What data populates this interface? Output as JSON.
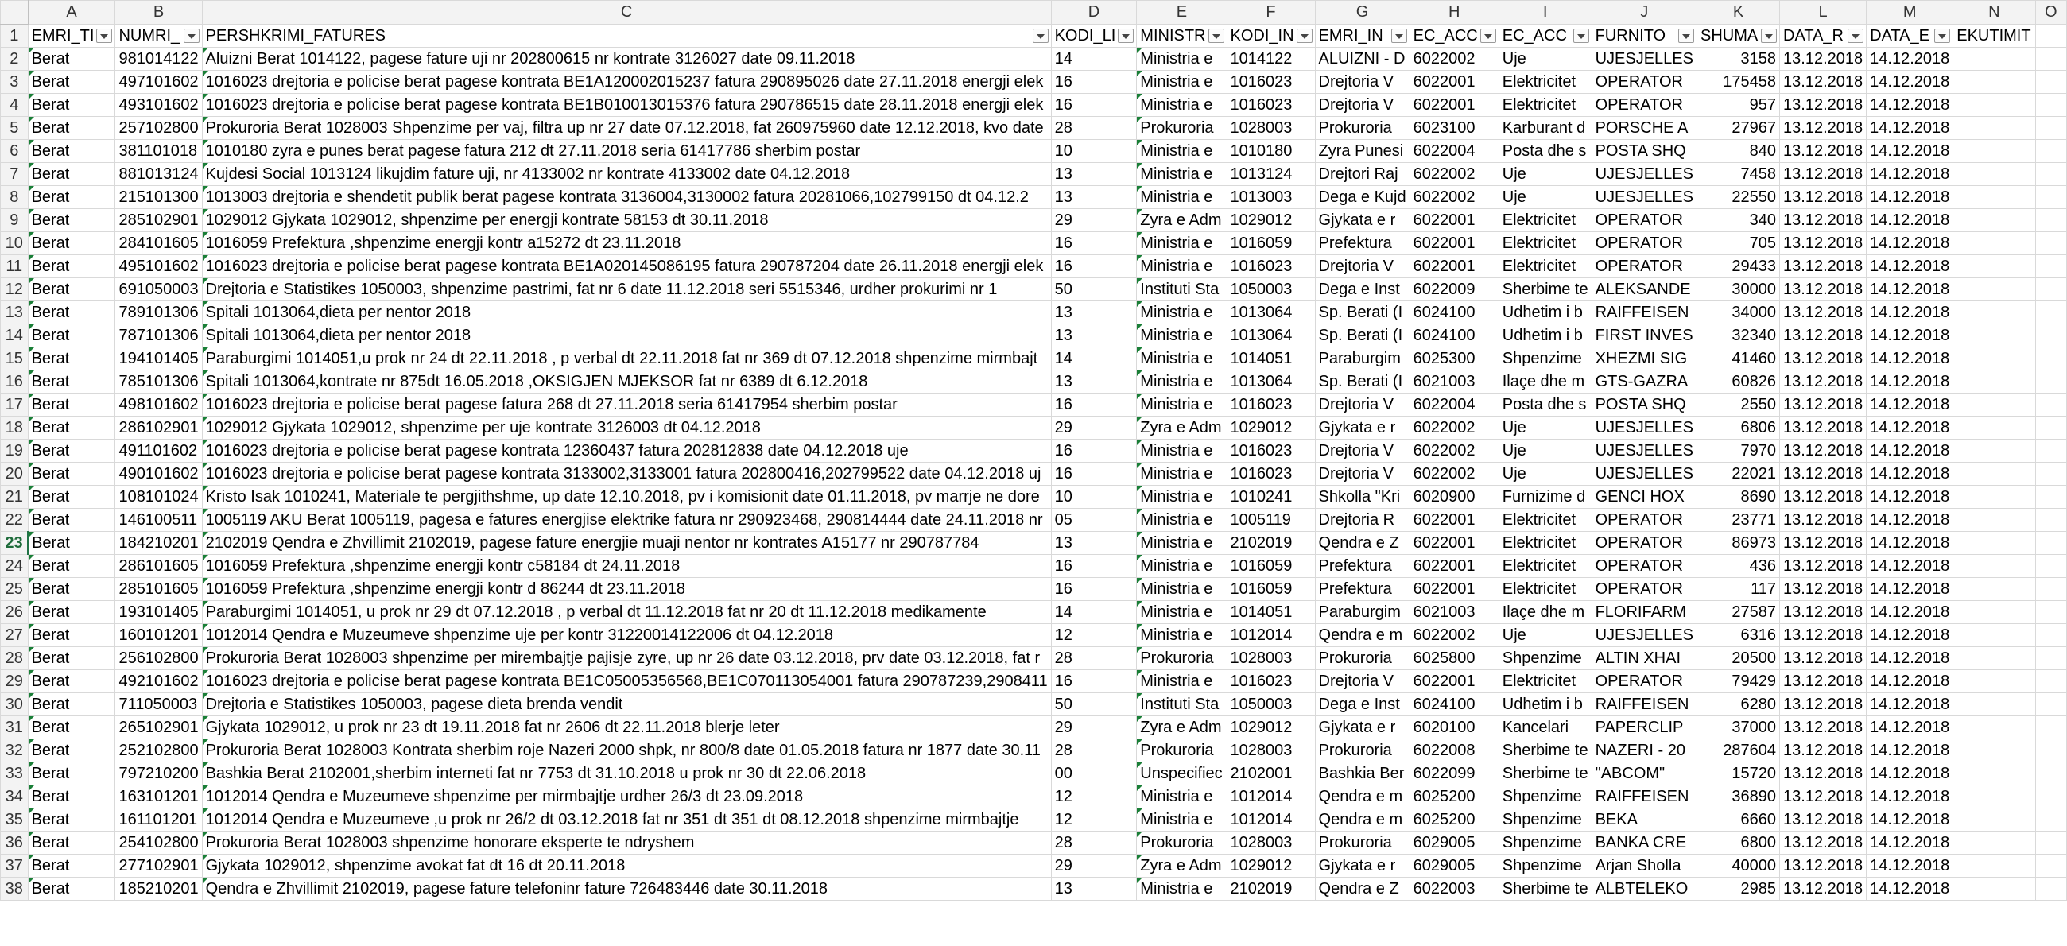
{
  "columns": [
    "A",
    "B",
    "C",
    "D",
    "E",
    "F",
    "G",
    "H",
    "I",
    "J",
    "K",
    "L",
    "M",
    "N",
    "O"
  ],
  "headers": [
    "EMRI_TI",
    "NUMRI_",
    "PERSHKRIMI_FATURES",
    "KODI_LI",
    "MINISTR",
    "KODI_IN",
    "EMRI_IN",
    "EC_ACC",
    "EC_ACC",
    "FURNITO",
    "SHUMA",
    "DATA_R",
    "DATA_E",
    "EKUTIMIT",
    ""
  ],
  "active_row": "23",
  "rows": [
    [
      "2",
      "Berat",
      "981014122",
      "Aluizni Berat 1014122, pagese fature uji nr 202800615 nr kontrate 3126027 date 09.11.2018",
      "14",
      "Ministria e",
      "1014122",
      "ALUIZNI - D",
      "6022002",
      "Uje",
      "UJESJELLES",
      "3158",
      "13.12.2018",
      "14.12.2018"
    ],
    [
      "3",
      "Berat",
      "497101602",
      "1016023 drejtoria e policise berat pagese kontrata BE1A120002015237 fatura 290895026 date 27.11.2018 energji elek",
      "16",
      "Ministria e",
      "1016023",
      "Drejtoria V",
      "6022001",
      "Elektricitet",
      "OPERATOR",
      "175458",
      "13.12.2018",
      "14.12.2018"
    ],
    [
      "4",
      "Berat",
      "493101602",
      "1016023 drejtoria e policise berat pagese kontrata BE1B010013015376 fatura 290786515 date 28.11.2018 energji elek",
      "16",
      "Ministria e",
      "1016023",
      "Drejtoria V",
      "6022001",
      "Elektricitet",
      "OPERATOR",
      "957",
      "13.12.2018",
      "14.12.2018"
    ],
    [
      "5",
      "Berat",
      "257102800",
      "Prokuroria Berat 1028003 Shpenzime per vaj, filtra up nr 27 date 07.12.2018, fat 260975960 date 12.12.2018, kvo date",
      "28",
      "Prokuroria",
      "1028003",
      "Prokuroria",
      "6023100",
      "Karburant d",
      "PORSCHE A",
      "27967",
      "13.12.2018",
      "14.12.2018"
    ],
    [
      "6",
      "Berat",
      "381101018",
      "1010180 zyra e punes berat pagese  fatura 212 dt 27.11.2018 seria 61417786 sherbim postar",
      "10",
      "Ministria e",
      "1010180",
      "Zyra Punesi",
      "6022004",
      "Posta dhe s",
      "POSTA SHQ",
      "840",
      "13.12.2018",
      "14.12.2018"
    ],
    [
      "7",
      "Berat",
      "881013124",
      "Kujdesi Social 1013124 likujdim fature uji, nr 4133002 nr kontrate 4133002 date 04.12.2018",
      "13",
      "Ministria e",
      "1013124",
      "Drejtori Raj",
      "6022002",
      "Uje",
      "UJESJELLES",
      "7458",
      "13.12.2018",
      "14.12.2018"
    ],
    [
      "8",
      "Berat",
      "215101300",
      "1013003 drejtoria e shendetit publik berat   pagese kontrata 3136004,3130002 fatura 20281066,102799150 dt 04.12.2",
      "13",
      "Ministria e",
      "1013003",
      "Dega e Kujd",
      "6022002",
      "Uje",
      "UJESJELLES",
      "22550",
      "13.12.2018",
      "14.12.2018"
    ],
    [
      "9",
      "Berat",
      "285102901",
      "1029012 Gjykata 1029012, shpenzime per energji kontrate 58153 dt 30.11.2018",
      "29",
      "Zyra e Adm",
      "1029012",
      "Gjykata e r",
      "6022001",
      "Elektricitet",
      "OPERATOR",
      "340",
      "13.12.2018",
      "14.12.2018"
    ],
    [
      "10",
      "Berat",
      "284101605",
      "1016059 Prefektura ,shpenzime energji kontr a15272 dt 23.11.2018",
      "16",
      "Ministria e",
      "1016059",
      "Prefektura",
      "6022001",
      "Elektricitet",
      "OPERATOR",
      "705",
      "13.12.2018",
      "14.12.2018"
    ],
    [
      "11",
      "Berat",
      "495101602",
      "1016023 drejtoria e policise berat pagese kontrata BE1A020145086195 fatura 290787204 date 26.11.2018 energji elek",
      "16",
      "Ministria e",
      "1016023",
      "Drejtoria V",
      "6022001",
      "Elektricitet",
      "OPERATOR",
      "29433",
      "13.12.2018",
      "14.12.2018"
    ],
    [
      "12",
      "Berat",
      "691050003",
      "Drejtoria e Statistikes 1050003, shpenzime pastrimi, fat nr 6 date 11.12.2018 seri 5515346, urdher prokurimi nr 1",
      "50",
      "Instituti Sta",
      "1050003",
      "Dega e Inst",
      "6022009",
      "Sherbime te",
      "ALEKSANDE",
      "30000",
      "13.12.2018",
      "14.12.2018"
    ],
    [
      "13",
      "Berat",
      "789101306",
      "Spitali 1013064,dieta per nentor 2018",
      "13",
      "Ministria e",
      "1013064",
      "Sp. Berati (I",
      "6024100",
      "Udhetim i b",
      "RAIFFEISEN",
      "34000",
      "13.12.2018",
      "14.12.2018"
    ],
    [
      "14",
      "Berat",
      "787101306",
      "Spitali 1013064,dieta per nentor 2018",
      "13",
      "Ministria e",
      "1013064",
      "Sp. Berati (I",
      "6024100",
      "Udhetim i b",
      "FIRST INVES",
      "32340",
      "13.12.2018",
      "14.12.2018"
    ],
    [
      "15",
      "Berat",
      "194101405",
      "Paraburgimi 1014051,u prok nr 24 dt 22.11.2018 , p verbal dt 22.11.2018 fat nr 369 dt 07.12.2018 shpenzime mirmbajt",
      "14",
      "Ministria e",
      "1014051",
      "Paraburgim",
      "6025300",
      "Shpenzime",
      "XHEZMI SIG",
      "41460",
      "13.12.2018",
      "14.12.2018"
    ],
    [
      "16",
      "Berat",
      "785101306",
      "Spitali 1013064,kontrate nr 875dt 16.05.2018 ,OKSIGJEN MJEKSOR fat nr 6389 dt 6.12.2018",
      "13",
      "Ministria e",
      "1013064",
      "Sp. Berati (I",
      "6021003",
      "Ilaçe dhe m",
      "GTS-GAZRA",
      "60826",
      "13.12.2018",
      "14.12.2018"
    ],
    [
      "17",
      "Berat",
      "498101602",
      "1016023 drejtoria e policise berat pagese fatura 268 dt 27.11.2018 seria 61417954  sherbim postar",
      "16",
      "Ministria e",
      "1016023",
      "Drejtoria V",
      "6022004",
      "Posta dhe s",
      "POSTA SHQ",
      "2550",
      "13.12.2018",
      "14.12.2018"
    ],
    [
      "18",
      "Berat",
      "286102901",
      "1029012 Gjykata 1029012, shpenzime per uje kontrate 3126003 dt 04.12.2018",
      "29",
      "Zyra e Adm",
      "1029012",
      "Gjykata e r",
      "6022002",
      "Uje",
      "UJESJELLES",
      "6806",
      "13.12.2018",
      "14.12.2018"
    ],
    [
      "19",
      "Berat",
      "491101602",
      "1016023 drejtoria e policise berat pagese kontrata 12360437 fatura 202812838 date 04.12.2018 uje",
      "16",
      "Ministria e",
      "1016023",
      "Drejtoria V",
      "6022002",
      "Uje",
      "UJESJELLES",
      "7970",
      "13.12.2018",
      "14.12.2018"
    ],
    [
      "20",
      "Berat",
      "490101602",
      "1016023 drejtoria e policise berat pagese kontrata 3133002,3133001 fatura 202800416,202799522 date 04.12.2018 uj",
      "16",
      "Ministria e",
      "1016023",
      "Drejtoria V",
      "6022002",
      "Uje",
      "UJESJELLES",
      "22021",
      "13.12.2018",
      "14.12.2018"
    ],
    [
      "21",
      "Berat",
      "108101024",
      "Kristo Isak 1010241, Materiale te pergjithshme, up date 12.10.2018, pv i komisionit date 01.11.2018, pv marrje ne dore",
      "10",
      "Ministria e",
      "1010241",
      "Shkolla \"Kri",
      "6020900",
      "Furnizime d",
      "GENCI HOX",
      "8690",
      "13.12.2018",
      "14.12.2018"
    ],
    [
      "22",
      "Berat",
      "146100511",
      "1005119 AKU Berat 1005119, pagesa e fatures energjise elektrike fatura nr 290923468, 290814444 date 24.11.2018 nr",
      "05",
      "Ministria e",
      "1005119",
      "Drejtoria R",
      "6022001",
      "Elektricitet",
      "OPERATOR",
      "23771",
      "13.12.2018",
      "14.12.2018"
    ],
    [
      "23",
      "Berat",
      "184210201",
      "2102019 Qendra e Zhvillimit 2102019, pagese fature energjie muaji nentor nr kontrates A15177 nr  290787784",
      "13",
      "Ministria e",
      "2102019",
      "Qendra e Z",
      "6022001",
      "Elektricitet",
      "OPERATOR",
      "86973",
      "13.12.2018",
      "14.12.2018"
    ],
    [
      "24",
      "Berat",
      "286101605",
      "1016059 Prefektura ,shpenzime energji kontr c58184 dt 24.11.2018",
      "16",
      "Ministria e",
      "1016059",
      "Prefektura",
      "6022001",
      "Elektricitet",
      "OPERATOR",
      "436",
      "13.12.2018",
      "14.12.2018"
    ],
    [
      "25",
      "Berat",
      "285101605",
      "1016059 Prefektura ,shpenzime energji kontr d 86244 dt 23.11.2018",
      "16",
      "Ministria e",
      "1016059",
      "Prefektura",
      "6022001",
      "Elektricitet",
      "OPERATOR",
      "117",
      "13.12.2018",
      "14.12.2018"
    ],
    [
      "26",
      "Berat",
      "193101405",
      "Paraburgimi 1014051, u prok nr 29 dt 07.12.2018 , p verbal dt 11.12.2018 fat nr 20 dt 11.12.2018 medikamente",
      "14",
      "Ministria e",
      "1014051",
      "Paraburgim",
      "6021003",
      "Ilaçe dhe m",
      "FLORIFARM",
      "27587",
      "13.12.2018",
      "14.12.2018"
    ],
    [
      "27",
      "Berat",
      "160101201",
      "1012014 Qendra e Muzeumeve shpenzime uje per kontr 31220014122006 dt 04.12.2018",
      "12",
      "Ministria e",
      "1012014",
      "Qendra e m",
      "6022002",
      "Uje",
      "UJESJELLES",
      "6316",
      "13.12.2018",
      "14.12.2018"
    ],
    [
      "28",
      "Berat",
      "256102800",
      "Prokuroria Berat 1028003 shpenzime per mirembajtje pajisje zyre, up nr 26 date 03.12.2018, prv date 03.12.2018, fat r",
      "28",
      "Prokuroria",
      "1028003",
      "Prokuroria",
      "6025800",
      "Shpenzime",
      "ALTIN XHAI",
      "20500",
      "13.12.2018",
      "14.12.2018"
    ],
    [
      "29",
      "Berat",
      "492101602",
      "1016023 drejtoria e policise berat pagese kontrata BE1C05005356568,BE1C070113054001 fatura 290787239,2908411",
      "16",
      "Ministria e",
      "1016023",
      "Drejtoria V",
      "6022001",
      "Elektricitet",
      "OPERATOR",
      "79429",
      "13.12.2018",
      "14.12.2018"
    ],
    [
      "30",
      "Berat",
      "711050003",
      "Drejtoria e Statistikes 1050003, pagese dieta brenda vendit",
      "50",
      "Instituti Sta",
      "1050003",
      "Dega e Inst",
      "6024100",
      "Udhetim i b",
      "RAIFFEISEN",
      "6280",
      "13.12.2018",
      "14.12.2018"
    ],
    [
      "31",
      "Berat",
      "265102901",
      "Gjykata 1029012, u prok nr 23 dt 19.11.2018 fat nr 2606 dt 22.11.2018 blerje leter",
      "29",
      "Zyra e Adm",
      "1029012",
      "Gjykata e r",
      "6020100",
      "Kancelari",
      "PAPERCLIP",
      "37000",
      "13.12.2018",
      "14.12.2018"
    ],
    [
      "32",
      "Berat",
      "252102800",
      "Prokuroria Berat 1028003 Kontrata sherbim roje Nazeri 2000 shpk, nr 800/8 date 01.05.2018 fatura nr 1877 date 30.11",
      "28",
      "Prokuroria",
      "1028003",
      "Prokuroria",
      "6022008",
      "Sherbime te",
      "NAZERI - 20",
      "287604",
      "13.12.2018",
      "14.12.2018"
    ],
    [
      "33",
      "Berat",
      "797210200",
      "Bashkia Berat 2102001,sherbim interneti fat nr 7753 dt 31.10.2018 u prok nr 30 dt 22.06.2018",
      "00",
      "Unspecifiec",
      "2102001",
      "Bashkia Ber",
      "6022099",
      "Sherbime te",
      "\"ABCOM\"",
      "15720",
      "13.12.2018",
      "14.12.2018"
    ],
    [
      "34",
      "Berat",
      "163101201",
      "1012014 Qendra e Muzeumeve shpenzime per mirmbajtje urdher 26/3 dt 23.09.2018",
      "12",
      "Ministria e",
      "1012014",
      "Qendra e m",
      "6025200",
      "Shpenzime",
      "RAIFFEISEN",
      "36890",
      "13.12.2018",
      "14.12.2018"
    ],
    [
      "35",
      "Berat",
      "161101201",
      "1012014 Qendra e Muzeumeve ,u prok nr 26/2 dt 03.12.2018 fat nr 351 dt 351 dt 08.12.2018 shpenzime  mirmbajtje",
      "12",
      "Ministria e",
      "1012014",
      "Qendra e m",
      "6025200",
      "Shpenzime",
      "BEKA",
      "6660",
      "13.12.2018",
      "14.12.2018"
    ],
    [
      "36",
      "Berat",
      "254102800",
      "Prokuroria Berat 1028003 shpenzime honorare eksperte te ndryshem",
      "28",
      "Prokuroria",
      "1028003",
      "Prokuroria",
      "6029005",
      "Shpenzime",
      "BANKA CRE",
      "6800",
      "13.12.2018",
      "14.12.2018"
    ],
    [
      "37",
      "Berat",
      "277102901",
      "Gjykata 1029012, shpenzime avokat  fat dt 16 dt 20.11.2018",
      "29",
      "Zyra e Adm",
      "1029012",
      "Gjykata e r",
      "6029005",
      "Shpenzime",
      "Arjan Sholla",
      "40000",
      "13.12.2018",
      "14.12.2018"
    ],
    [
      "38",
      "Berat",
      "185210201",
      "Qendra e Zhvillimit 2102019, pagese fature telefoninr fature 726483446 date 30.11.2018",
      "13",
      "Ministria e",
      "2102019",
      "Qendra e Z",
      "6022003",
      "Sherbime te",
      "ALBTELEKO",
      "2985",
      "13.12.2018",
      "14.12.2018"
    ]
  ]
}
